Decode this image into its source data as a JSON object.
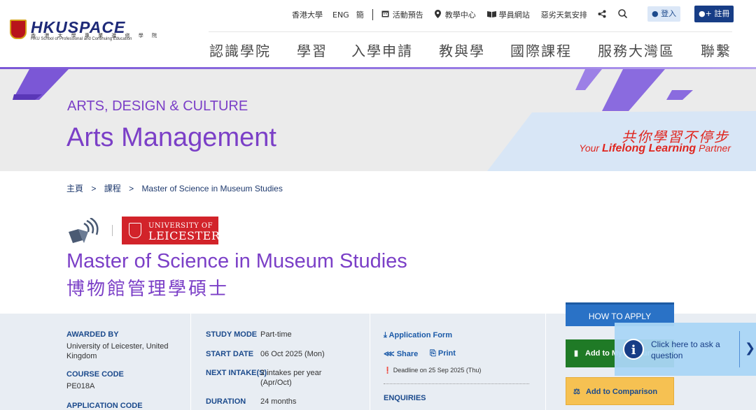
{
  "brand": {
    "name": "HKUSPACE",
    "zh": "香 港 大 學 專 業 進 修 學 院",
    "en": "HKU School of Professional and Continuing Education"
  },
  "util": {
    "hku": "香港大學",
    "eng": "ENG",
    "simp": "簡",
    "events": "活動預告",
    "centres": "教學中心",
    "student": "學員網站",
    "weather": "惡劣天氣安排",
    "login": "登入",
    "register": "註冊"
  },
  "nav": [
    "認識學院",
    "學習",
    "入學申請",
    "教與學",
    "國際課程",
    "服務大灣區",
    "聯繫"
  ],
  "hero": {
    "kicker": "ARTS, DESIGN & CULTURE",
    "title": "Arts Management",
    "slogan_zh": "共你學習不停步",
    "slogan_en_pre": "Your",
    "slogan_en_bold": "Lifelong Learning",
    "slogan_en_post": "Partner"
  },
  "breadcrumb": {
    "home": "主頁",
    "courses": "課程",
    "current": "Master of Science in Museum Studies",
    "sep": ">"
  },
  "partner": {
    "line1": "UNIVERSITY OF",
    "line2": "LEICESTER"
  },
  "programme": {
    "title_en": "Master of Science in Museum Studies",
    "title_zh": "博物館管理學碩士"
  },
  "info": {
    "awarded_by_label": "AWARDED BY",
    "awarded_by": "University of Leicester, United Kingdom",
    "course_code_label": "COURSE CODE",
    "course_code": "PE018A",
    "app_code_label": "APPLICATION CODE",
    "study_mode_label": "STUDY MODE",
    "study_mode": "Part-time",
    "start_date_label": "START DATE",
    "start_date": "06 Oct 2025 (Mon)",
    "next_intake_label": "NEXT INTAKE(S)",
    "next_intake": "2 intakes per year (Apr/Oct)",
    "duration_label": "DURATION",
    "duration": "24 months"
  },
  "actions": {
    "app_form": "Application Form",
    "share": "Share",
    "print": "Print",
    "deadline": "Deadline on 25 Sep 2025 (Thu)",
    "enquiries": "ENQUIRIES"
  },
  "cta": {
    "how_to_apply": "HOW TO APPLY",
    "add_to": "Add to My Favourites",
    "add_comparison": "Add to Comparison"
  },
  "chat": {
    "text": "Click here to ask a question"
  },
  "colors": {
    "purple": "#7b3fc7",
    "navy": "#173d86",
    "red": "#d2232a",
    "green": "#1f7a26",
    "amber": "#f6c152"
  }
}
